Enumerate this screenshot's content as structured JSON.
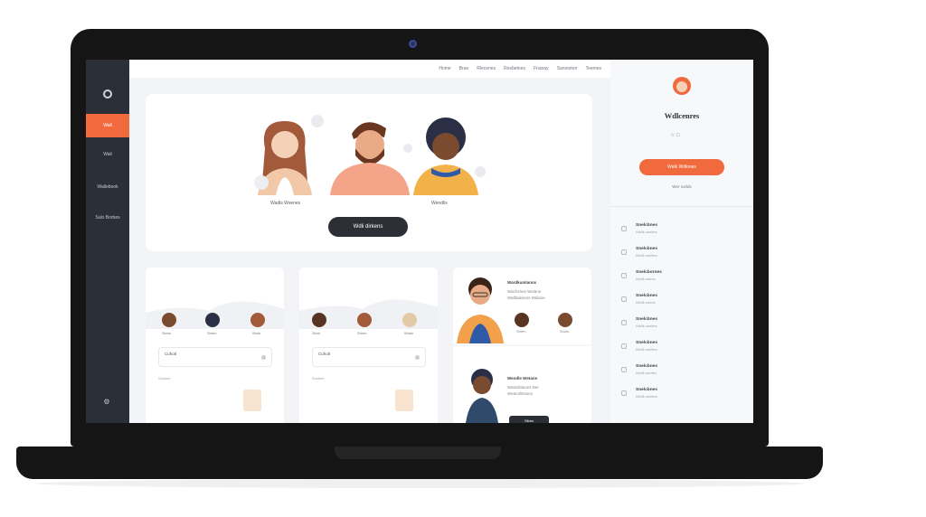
{
  "sidebar": {
    "items": [
      {
        "label": "Wall",
        "active": true
      },
      {
        "label": "Wali",
        "active": false
      },
      {
        "label": "Wallebook",
        "active": false
      },
      {
        "label": "Sulo Borbes",
        "active": false
      }
    ]
  },
  "topnav": {
    "links": [
      "Home",
      "Brae",
      "Rlecenes",
      "Resbetnes",
      "Fnanay",
      "Sanosmor",
      "Teemes"
    ]
  },
  "hero": {
    "person_labels": [
      "Wadls Wsenes",
      "",
      "Wendlis"
    ],
    "button_label": "Wdli dirkens"
  },
  "cards": [
    {
      "mini_labels": [
        "Slono",
        "Smen",
        "Wuto"
      ],
      "field_value": "Cuhotl",
      "meta": "Sonkee"
    },
    {
      "mini_labels": [
        "Slorn",
        "Smen",
        "Wudo"
      ],
      "field_value": "Cuhotl",
      "meta": "Sonkee"
    }
  ],
  "wide_card": {
    "top_title": "Wardkumlanns",
    "top_lines": [
      "Wachsnes Welane",
      "Wallbakness Walane"
    ],
    "top_mini_labels": [
      "Smen",
      "Wudo"
    ],
    "bottom_title": "Wendle Wetane",
    "bottom_lines": [
      "Wanisiblaons Ber",
      "Weanoltisions"
    ],
    "bottom_button": "Slbes"
  },
  "right_panel": {
    "welcome": "Wdlcenres",
    "button_label": "Welk Wdlones",
    "subtext": "Wer sorlds",
    "list": [
      {
        "title": "Snelcbnes",
        "sub": "Weilk oneltes"
      },
      {
        "title": "Snelcbnes",
        "sub": "Weilk oneltes"
      },
      {
        "title": "Snelcbornes",
        "sub": "Weilk eaees"
      },
      {
        "title": "Snelcbnes",
        "sub": "Weilk eaees"
      },
      {
        "title": "Snelcbnes",
        "sub": "Weilk oneltes"
      },
      {
        "title": "Snelcbnes",
        "sub": "Weilk oneltes"
      },
      {
        "title": "Snelcbnes",
        "sub": "Weilk orertes"
      },
      {
        "title": "Snelcbnes",
        "sub": "Weilk oneltes"
      }
    ]
  },
  "colors": {
    "accent": "#f06a3e",
    "sidebar": "#2b3038",
    "dark_button": "#2c2f36"
  }
}
